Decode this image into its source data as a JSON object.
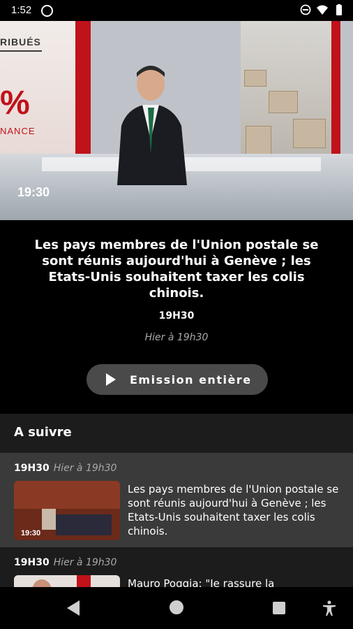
{
  "status": {
    "time": "1:52",
    "icons": [
      "dnd-icon",
      "wifi-icon",
      "battery-icon"
    ]
  },
  "video": {
    "overlay_label": "RIBUÉS",
    "overlay_pct": "%",
    "overlay_label2": "NANCE",
    "logo": "19:30"
  },
  "episode": {
    "headline": "Les pays membres de l'Union postale se sont réunis aujourd'hui à Genève ; les Etats-Unis souhaitent taxer les colis chinois.",
    "program": "19H30",
    "date": "Hier à 19h30",
    "full_button": "Emission entière"
  },
  "next": {
    "header": "A suivre",
    "items": [
      {
        "program": "19H30",
        "date": "Hier à 19h30",
        "title": "Les pays membres de l'Union postale se sont réunis aujourd'hui à Genève ; les Etats-Unis souhaitent taxer les colis chinois."
      },
      {
        "program": "19H30",
        "date": "Hier à 19h30",
        "title": "Mauro Poggia: \"Je rassure la"
      }
    ]
  },
  "colors": {
    "accent": "#c0121b",
    "card": "#3a3a3a",
    "header": "#1c1c1c"
  }
}
